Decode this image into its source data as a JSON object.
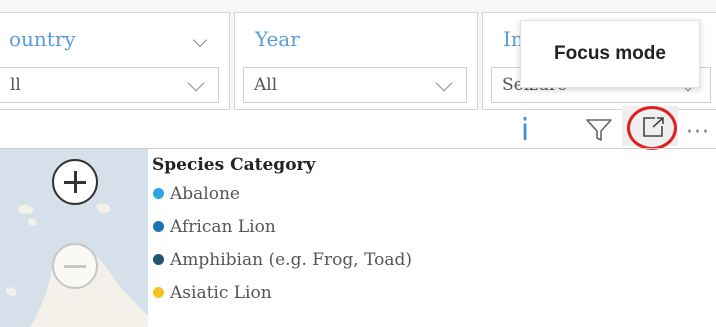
{
  "slicers": [
    {
      "title": "ountry",
      "value": "ll"
    },
    {
      "title": "Year",
      "value": "All"
    },
    {
      "title": "In",
      "value": "Seizure"
    }
  ],
  "toolbar": {
    "tooltip": "Focus mode",
    "info_glyph": "i",
    "more_glyph": "···",
    "icons": [
      "info-icon",
      "filter-icon",
      "focus-mode-icon",
      "more-options-icon"
    ]
  },
  "map": {
    "zoom_in_icon": "plus-icon",
    "zoom_out_icon": "minus-icon"
  },
  "legend": {
    "title": "Species Category",
    "items": [
      {
        "label": "Abalone",
        "color": "#2aa6e0"
      },
      {
        "label": "African Lion",
        "color": "#1a73b5"
      },
      {
        "label": "Amphibian (e.g. Frog, Toad)",
        "color": "#1e5570"
      },
      {
        "label": "Asiatic Lion",
        "color": "#f6c421"
      }
    ]
  },
  "colors": {
    "accent": "#5b9bd5",
    "highlight_ring": "#e01f1f"
  }
}
